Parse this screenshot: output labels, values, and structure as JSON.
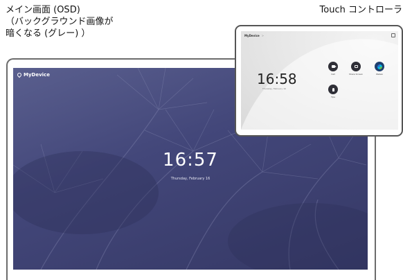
{
  "labels": {
    "osd": "メイン画面 (OSD)\n（バックグラウンド画像が\n暗くなる (グレー) ）",
    "touch": "Touch コントローラ"
  },
  "osd": {
    "device_name": "MyDevice",
    "time": "16:57",
    "date": "Thursday, February 16"
  },
  "touch": {
    "device_name": "MyDevice",
    "device_suffix": ">",
    "time": "16:58",
    "date": "Thursday, February 16",
    "buttons": [
      {
        "label": "Call",
        "icon": "camera-icon"
      },
      {
        "label": "Share Screen",
        "icon": "share-screen-icon"
      },
      {
        "label": "Webex",
        "icon": "webex-icon"
      },
      {
        "label": "Tips",
        "icon": "lightbulb-icon"
      }
    ]
  },
  "colors": {
    "osd_background": "#43477a",
    "button_dark": "#2f2f37",
    "frame": "#6b6b6b"
  }
}
